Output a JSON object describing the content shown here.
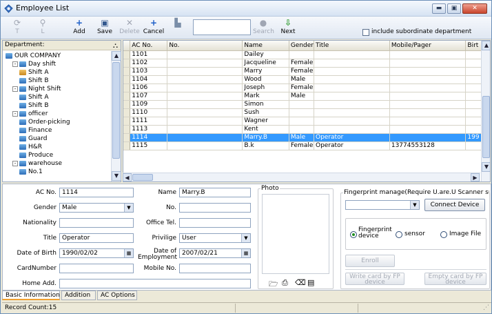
{
  "window": {
    "title": "Employee List"
  },
  "toolbar": {
    "buttons": [
      {
        "label": "",
        "icon": "refresh-icon"
      },
      {
        "label": "",
        "icon": "filter-icon"
      },
      {
        "label": "Add",
        "icon": "plus-icon"
      },
      {
        "label": "Save",
        "icon": "disk-icon"
      },
      {
        "label": "Delete",
        "icon": "x-icon"
      },
      {
        "label": "Cancel",
        "icon": "plus-icon"
      },
      {
        "label": "",
        "icon": "building-icon"
      },
      {
        "label": "Search",
        "icon": "bulb-icon"
      },
      {
        "label": "Next",
        "icon": "arrow-down-icon"
      }
    ],
    "search_value": "",
    "include_sub_label": "include subordinate department"
  },
  "department": {
    "header": "Department:",
    "nodes": [
      {
        "label": "OUR COMPANY",
        "level": 0,
        "exp": ""
      },
      {
        "label": "Day shift",
        "level": 1,
        "exp": "-"
      },
      {
        "label": "Shift A",
        "level": 2,
        "exp": "",
        "selected": true
      },
      {
        "label": "Shift B",
        "level": 2,
        "exp": ""
      },
      {
        "label": "Night Shift",
        "level": 1,
        "exp": "-"
      },
      {
        "label": "Shift A",
        "level": 2,
        "exp": ""
      },
      {
        "label": "Shift B",
        "level": 2,
        "exp": ""
      },
      {
        "label": "officer",
        "level": 1,
        "exp": "-"
      },
      {
        "label": "Order-picking",
        "level": 2,
        "exp": ""
      },
      {
        "label": "Finance",
        "level": 2,
        "exp": ""
      },
      {
        "label": "Guard",
        "level": 2,
        "exp": ""
      },
      {
        "label": "H&R",
        "level": 2,
        "exp": ""
      },
      {
        "label": "Produce",
        "level": 2,
        "exp": ""
      },
      {
        "label": "warehouse",
        "level": 1,
        "exp": "-"
      },
      {
        "label": "No.1",
        "level": 2,
        "exp": ""
      }
    ]
  },
  "grid": {
    "columns": [
      "AC No.",
      "No.",
      "Name",
      "Gender",
      "Title",
      "Mobile/Pager",
      "Birt"
    ],
    "rows": [
      {
        "ac": "1101",
        "no": "",
        "name": "Dailey",
        "gender": "",
        "title": "",
        "mobile": "",
        "birth": ""
      },
      {
        "ac": "1102",
        "no": "",
        "name": "Jacqueline",
        "gender": "Female",
        "title": "",
        "mobile": "",
        "birth": ""
      },
      {
        "ac": "1103",
        "no": "",
        "name": "Marry",
        "gender": "Female",
        "title": "",
        "mobile": "",
        "birth": ""
      },
      {
        "ac": "1104",
        "no": "",
        "name": "Wood",
        "gender": "Male",
        "title": "",
        "mobile": "",
        "birth": ""
      },
      {
        "ac": "1106",
        "no": "",
        "name": "Joseph",
        "gender": "Female",
        "title": "",
        "mobile": "",
        "birth": ""
      },
      {
        "ac": "1107",
        "no": "",
        "name": "Mark",
        "gender": "Male",
        "title": "",
        "mobile": "",
        "birth": ""
      },
      {
        "ac": "1109",
        "no": "",
        "name": "Simon",
        "gender": "",
        "title": "",
        "mobile": "",
        "birth": ""
      },
      {
        "ac": "1110",
        "no": "",
        "name": "Sush",
        "gender": "",
        "title": "",
        "mobile": "",
        "birth": ""
      },
      {
        "ac": "1111",
        "no": "",
        "name": "Wagner",
        "gender": "",
        "title": "",
        "mobile": "",
        "birth": ""
      },
      {
        "ac": "1113",
        "no": "",
        "name": "Kent",
        "gender": "",
        "title": "",
        "mobile": "",
        "birth": ""
      },
      {
        "ac": "1114",
        "no": "",
        "name": "Marry.B",
        "gender": "Male",
        "title": "Operator",
        "mobile": "",
        "birth": "199",
        "selected": true
      },
      {
        "ac": "1115",
        "no": "",
        "name": "B.k",
        "gender": "Female",
        "title": "Operator",
        "mobile": "13774553128",
        "birth": ""
      }
    ]
  },
  "detail": {
    "ac_no_label": "AC No.",
    "ac_no": "1114",
    "gender_label": "Gender",
    "gender": "Male",
    "nationality_label": "Nationality",
    "nationality": "",
    "title_label": "Title",
    "title": "Operator",
    "dob_label": "Date of Birth",
    "dob": "1990/02/02",
    "card_label": "CardNumber",
    "card": "",
    "home_label": "Home Add.",
    "home": "",
    "name_label": "Name",
    "name": "Marry.B",
    "no_label": "No.",
    "no": "",
    "office_label": "Office Tel.",
    "office": "",
    "privilege_label": "Privilige",
    "privilege": "User",
    "doe_label": "Date of Employment",
    "doe": "2007/02/21",
    "mobile_label": "Mobile No.",
    "mobile": "",
    "photo_label": "Photo",
    "fp_label": "Fingerprint manage(Require U.are.U Scanner supp",
    "connect_label": "Connect Device",
    "radio_fp": "Fingerprint device",
    "radio_sensor": "sensor",
    "radio_image": "Image File",
    "enroll_label": "Enroll",
    "write_label": "Write card by FP device",
    "empty_label": "Empty card by FP device"
  },
  "tabs": [
    "Basic Information",
    "Addition",
    "AC Options"
  ],
  "status": {
    "record_count": "Record Count:15"
  }
}
